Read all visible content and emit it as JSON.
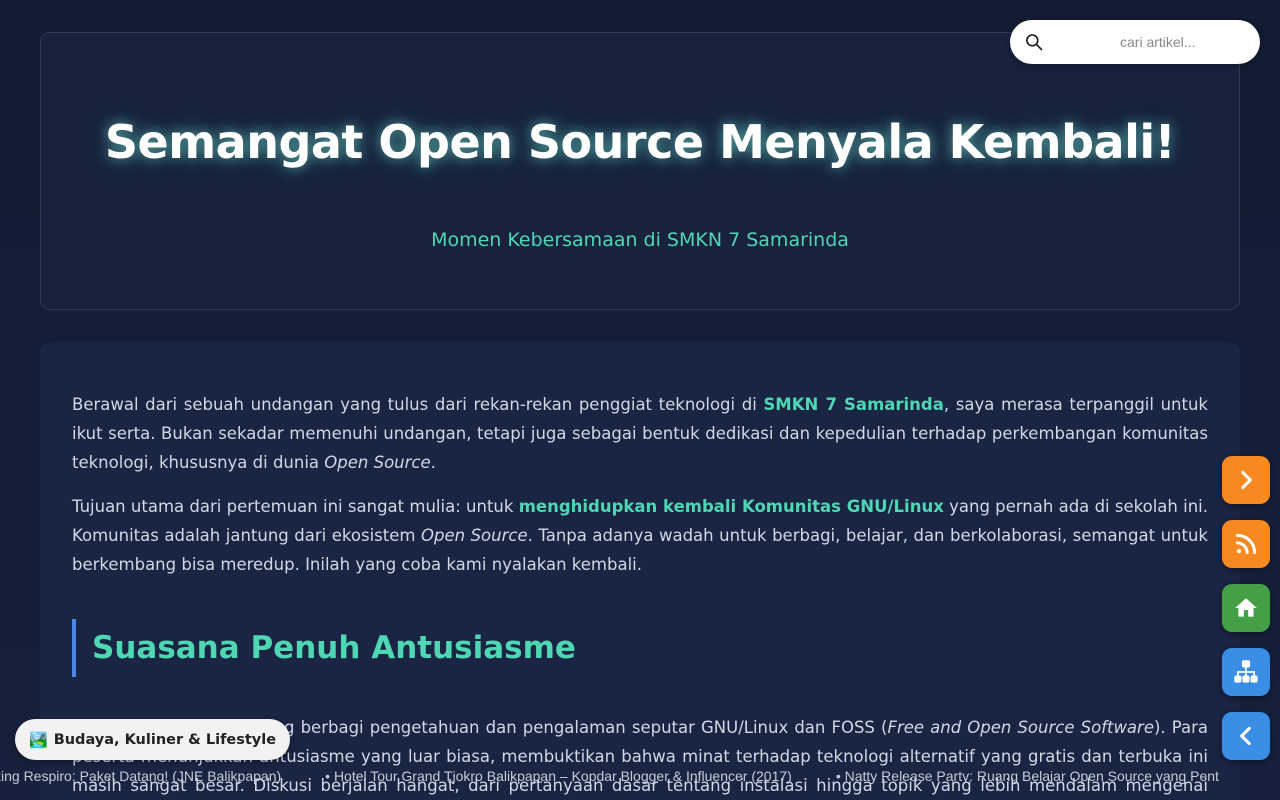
{
  "header": {
    "title": "Semangat Open Source Menyala Kembali!",
    "subtitle": "Momen Kebersamaan di SMKN 7 Samarinda"
  },
  "search": {
    "placeholder": "cari artikel...",
    "icon": "search-icon"
  },
  "article": {
    "p1": {
      "a": "Berawal dari sebuah undangan yang tulus dari rekan-rekan penggiat teknologi di ",
      "b": "SMKN 7 Samarinda",
      "c": ", saya merasa terpanggil untuk ikut serta. Bukan sekadar memenuhi undangan, tetapi juga sebagai bentuk dedikasi dan kepedulian terhadap perkembangan komunitas teknologi, khususnya di dunia ",
      "d": "Open Source",
      "e": "."
    },
    "p2": {
      "a": "Tujuan utama dari pertemuan ini sangat mulia: untuk ",
      "b": "menghidupkan kembali Komunitas GNU/Linux",
      "c": " yang pernah ada di sekolah ini. Komunitas adalah jantung dari ekosistem ",
      "d": "Open Source",
      "e": ". Tanpa adanya wadah untuk berbagi, belajar, dan berkolaborasi, semangat untuk berkembang bisa meredup. Inilah yang coba kami nyalakan kembali."
    },
    "heading": "Suasana Penuh Antusiasme",
    "p3": {
      "a": "Kegiatan ini menjadi ajang berbagi pengetahuan dan pengalaman seputar GNU/Linux dan FOSS (",
      "b": "Free and Open Source Software",
      "c": "). Para peserta menunjukkan antusiasme yang luar biasa, membuktikan bahwa minat terhadap teknologi alternatif yang gratis dan terbuka ini masih sangat besar. Diskusi berjalan hangat, dari pertanyaan dasar tentang instalasi hingga topik yang lebih mendalam mengenai kustomisasi dan pemrograman."
    }
  },
  "category_badge": {
    "emoji": "🏞️",
    "label": "Budaya, Kuliner & Lifestyle"
  },
  "ticker": [
    "xing Respiro: Paket Datang! (JNE Balikpapan)",
    "• Hotel Tour Grand Tjokro Balikpapan – Kopdar Blogger & Influencer (2017)",
    "• Natty Release Party: Ruang Belajar Open Source yang Pent"
  ],
  "fabs": {
    "next": "chevron-right-icon",
    "rss": "rss-icon",
    "home": "home-icon",
    "sitemap": "sitemap-icon",
    "back": "chevron-left-icon"
  },
  "colors": {
    "accent": "#4fd6b3",
    "orange": "#f6891f",
    "green": "#43a047",
    "blue": "#3a8ee6"
  }
}
